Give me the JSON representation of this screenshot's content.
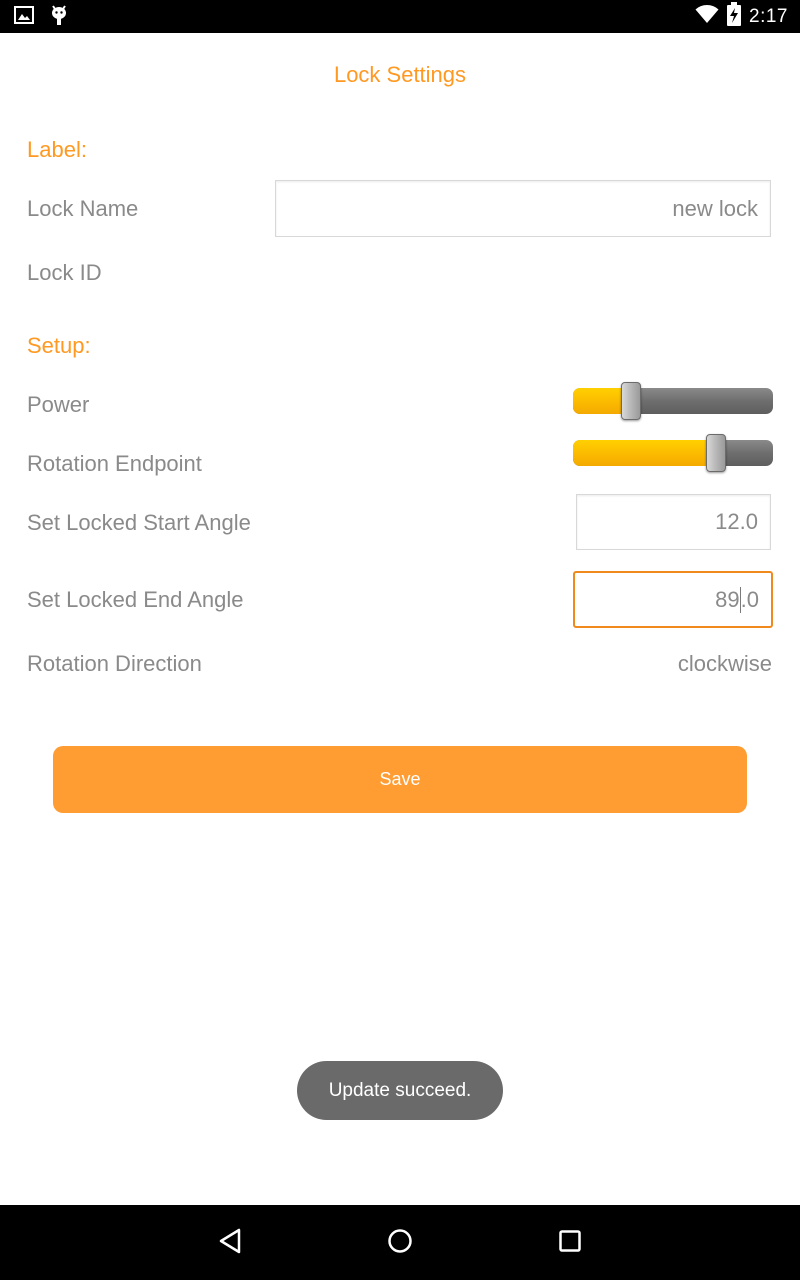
{
  "status_bar": {
    "time": "2:17",
    "left_icons": [
      "image-icon",
      "android-debug-icon"
    ],
    "right_icons": [
      "wifi-icon",
      "battery-charging-icon"
    ]
  },
  "page": {
    "title": "Lock Settings"
  },
  "label_section": {
    "header": "Label:",
    "lock_name_label": "Lock Name",
    "lock_name_value": "new lock",
    "lock_id_label": "Lock ID"
  },
  "setup_section": {
    "header": "Setup:",
    "power_label": "Power",
    "power_level": 0.29,
    "rotation_endpoint_label": "Rotation Endpoint",
    "rotation_endpoint_level": 0.715,
    "start_angle_label": "Set Locked Start Angle",
    "start_angle_value": "12.0",
    "end_angle_label": "Set Locked End Angle",
    "end_angle_value_before_cursor": "89",
    "end_angle_value_after_cursor": ".0",
    "rotation_direction_label": "Rotation Direction",
    "rotation_direction_value": "clockwise"
  },
  "actions": {
    "save_label": "Save"
  },
  "toast": {
    "message": "Update succeed."
  },
  "nav_bar": {
    "icons": [
      "back-icon",
      "home-icon",
      "recents-icon"
    ]
  },
  "colors": {
    "accent": "#ff9922",
    "button": "#ff9d33",
    "slider_fill": "#fbb800",
    "label_gray": "#8a8a8a"
  }
}
